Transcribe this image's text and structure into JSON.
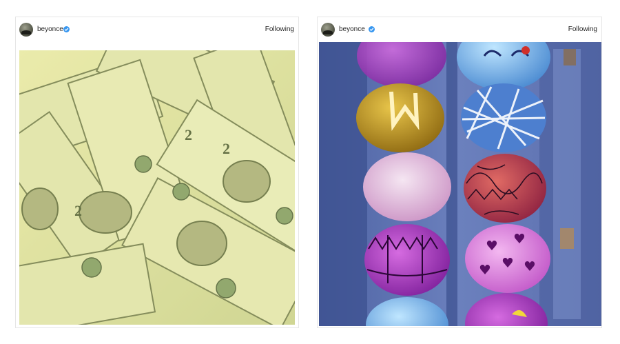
{
  "posts": [
    {
      "username": "beyonce",
      "follow_label": "Following",
      "verified": true,
      "image_icon": "money-bills-photo"
    },
    {
      "username": "beyonce",
      "follow_label": "Following",
      "verified": true,
      "image_icon": "easter-eggs-photo"
    }
  ],
  "colors": {
    "verified_badge": "#3897f0",
    "border": "#e6e6e6",
    "text": "#262626"
  }
}
